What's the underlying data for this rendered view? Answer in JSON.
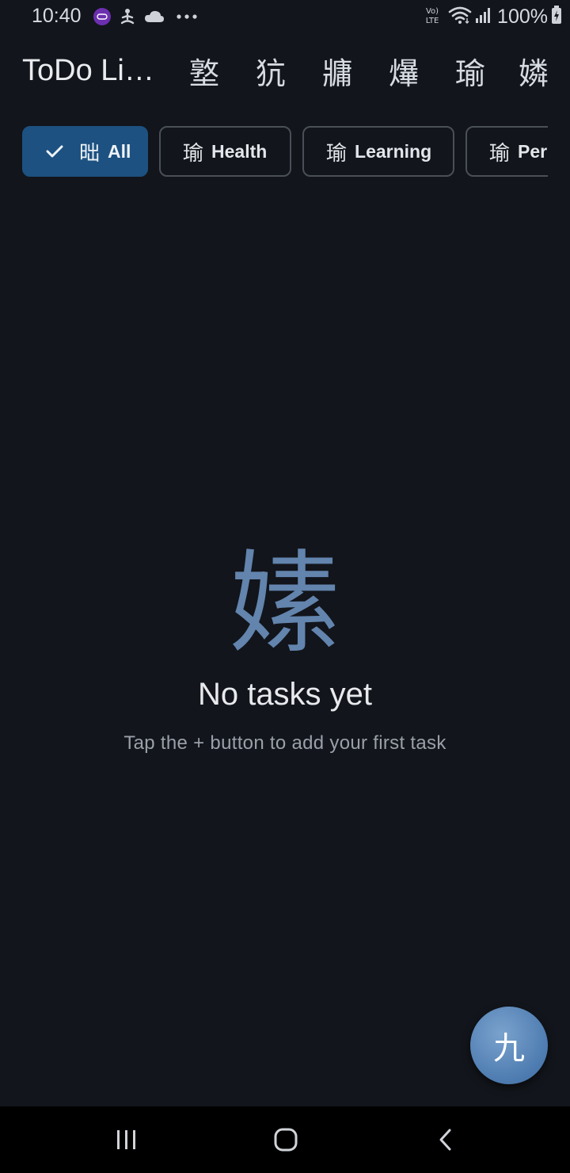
{
  "status_bar": {
    "time": "10:40",
    "notification_icons": [
      "webex-icon",
      "yoga-icon",
      "cloud-icon",
      "more-dots-icon"
    ],
    "network_label": "Vo) LTE",
    "battery": "100%"
  },
  "app_bar": {
    "title": "ToDo Li…",
    "actions": [
      {
        "name": "action-1",
        "glyph": "墪"
      },
      {
        "name": "action-2",
        "glyph": "犺"
      },
      {
        "name": "action-3",
        "glyph": "牅"
      },
      {
        "name": "action-4",
        "glyph": "爗"
      },
      {
        "name": "action-5",
        "glyph": "瑜"
      },
      {
        "name": "action-6",
        "glyph": "嫾"
      }
    ]
  },
  "filters": {
    "chips": [
      {
        "glyph": "昢",
        "label": "All",
        "selected": true
      },
      {
        "glyph": "瑜",
        "label": "Health",
        "selected": false
      },
      {
        "glyph": "瑜",
        "label": "Learning",
        "selected": false
      },
      {
        "glyph": "瑜",
        "label": "Per",
        "selected": false
      }
    ]
  },
  "empty_state": {
    "icon_glyph": "嫊",
    "title": "No tasks yet",
    "subtitle": "Tap the + button to add your first task"
  },
  "fab": {
    "glyph": "九"
  },
  "colors": {
    "background": "#12151b",
    "chip_selected": "#1d5181",
    "empty_icon": "#6284ad",
    "fab": "#4d7bb0"
  }
}
